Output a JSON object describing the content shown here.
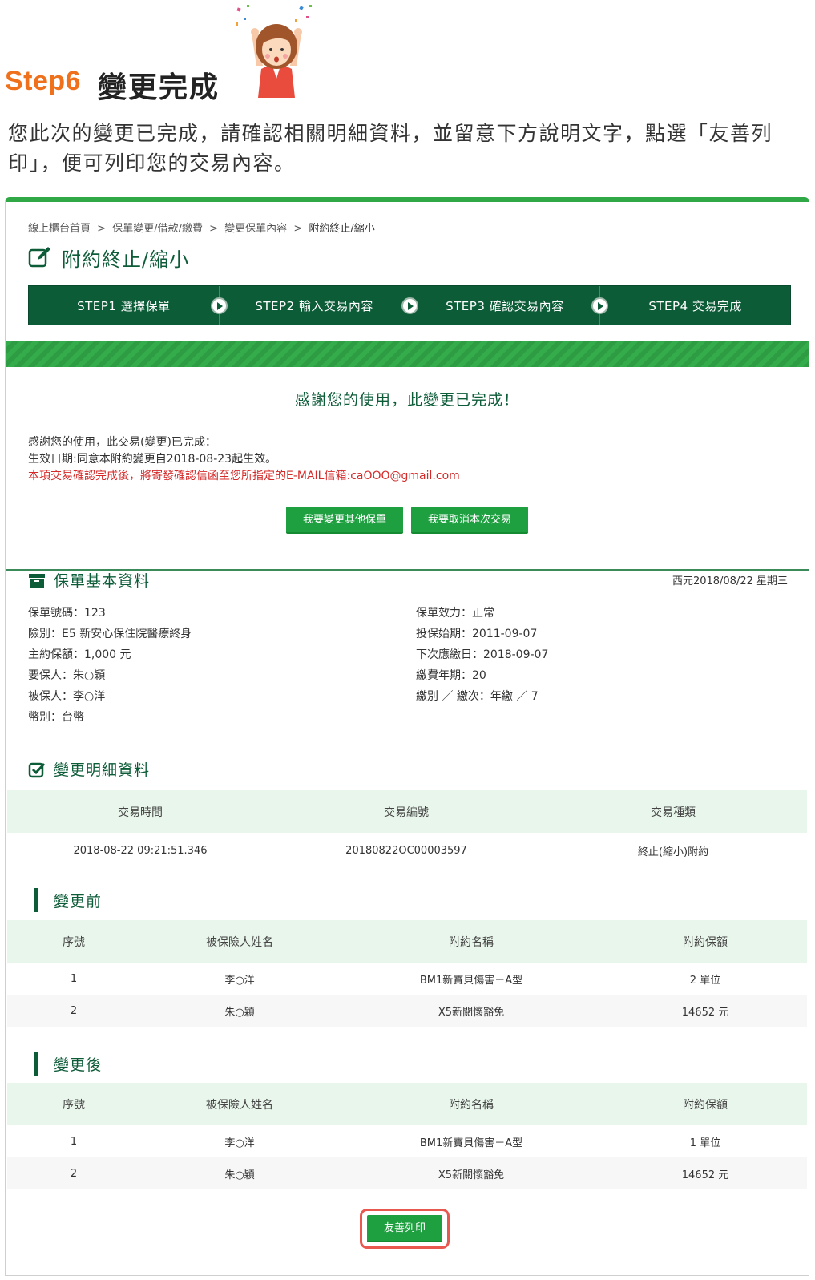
{
  "header": {
    "step_label": "Step6",
    "step_title": "變更完成",
    "intro": "您此次的變更已完成，請確認相關明細資料，並留意下方說明文字，點選「友善列印」，便可列印您的交易內容。"
  },
  "breadcrumb": {
    "items": [
      "線上櫃台首頁",
      ">",
      "保單變更/借款/繳費",
      ">",
      "變更保單內容",
      ">",
      "附約終止/縮小"
    ]
  },
  "page_title": "附約終止/縮小",
  "steps": [
    "STEP1 選擇保單",
    "STEP2 輸入交易內容",
    "STEP3 確認交易內容",
    "STEP4 交易完成"
  ],
  "done": {
    "title": "感謝您的使用，此變更已完成！",
    "line1": "感謝您的使用，此交易(變更)已完成：",
    "line2": "生效日期:同意本附約變更自2018-08-23起生效。",
    "line3": "本項交易確認完成後，將寄發確認信函至您所指定的E-MAIL信箱:caOOO@gmail.com",
    "btn_other": "我要變更其他保單",
    "btn_cancel": "我要取消本次交易"
  },
  "basic": {
    "title": "保單基本資料",
    "date": "西元2018/08/22 星期三",
    "left": [
      "保單號碼：123",
      "險別：E5 新安心保住院醫療終身",
      "主約保額：1,000 元",
      "要保人：朱○穎",
      "被保人：李○洋",
      "幣別：台幣"
    ],
    "right": [
      "保單效力：正常",
      "投保始期：2011-09-07",
      "下次應繳日：2018-09-07",
      "繳費年期：20",
      "繳別 ／ 繳次：年繳 ／ 7"
    ]
  },
  "detail": {
    "title": "變更明細資料",
    "headers": [
      "交易時間",
      "交易編號",
      "交易種類"
    ],
    "row": [
      "2018-08-22 09:21:51.346",
      "20180822OC00003597",
      "終止(縮小)附約"
    ]
  },
  "before": {
    "title": "變更前",
    "headers": [
      "序號",
      "被保險人姓名",
      "附約名稱",
      "附約保額"
    ],
    "rows": [
      [
        "1",
        "李○洋",
        "BM1新寶貝傷害－A型",
        "2 單位"
      ],
      [
        "2",
        "朱○穎",
        "X5新關懷豁免",
        "14652 元"
      ]
    ]
  },
  "after": {
    "title": "變更後",
    "headers": [
      "序號",
      "被保險人姓名",
      "附約名稱",
      "附約保額"
    ],
    "rows": [
      [
        "1",
        "李○洋",
        "BM1新寶貝傷害－A型",
        "1 單位"
      ],
      [
        "2",
        "朱○穎",
        "X5新關懷豁免",
        "14652 元"
      ]
    ]
  },
  "print_label": "友善列印",
  "colors": {
    "brand_green": "#0d5c38",
    "button_green": "#1fa040",
    "accent_orange": "#f0711c",
    "alert_red": "#d52a2a",
    "highlight_red": "#e8584f"
  }
}
